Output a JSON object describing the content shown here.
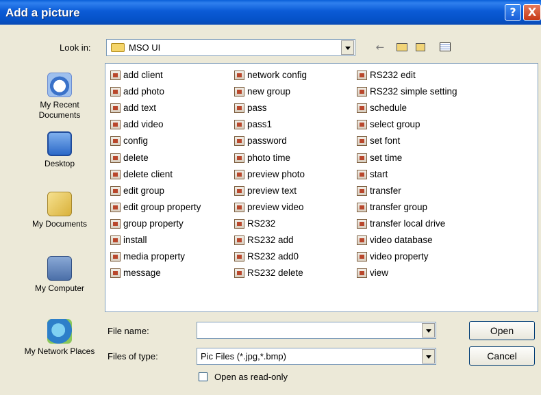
{
  "window": {
    "title": "Add a picture",
    "help_glyph": "?",
    "close_glyph": "X"
  },
  "look_in": {
    "label": "Look in:",
    "value": "MSO UI",
    "folder_icon": "folder-icon"
  },
  "toolbar": {
    "back_glyph": "←",
    "up_icon": "up-folder-icon",
    "new_folder_icon": "new-folder-icon",
    "views_icon": "views-menu-icon"
  },
  "places": [
    {
      "label": "My Recent Documents",
      "icon": "recent-documents-icon"
    },
    {
      "label": "Desktop",
      "icon": "desktop-icon"
    },
    {
      "label": "My Documents",
      "icon": "my-documents-icon"
    },
    {
      "label": "My Computer",
      "icon": "my-computer-icon"
    },
    {
      "label": "My Network Places",
      "icon": "network-places-icon"
    }
  ],
  "files": {
    "col1": [
      "add client",
      "add photo",
      "add text",
      "add video",
      "config",
      "delete",
      "delete client",
      "edit group",
      "edit group property",
      "group property",
      "install",
      "media property",
      "message"
    ],
    "col2": [
      "network config",
      "new group",
      "pass",
      "pass1",
      "password",
      "photo time",
      "preview photo",
      "preview text",
      "preview video",
      "RS232",
      "RS232 add",
      "RS232 add0",
      "RS232 delete"
    ],
    "col3": [
      "RS232 edit",
      "RS232 simple setting",
      "schedule",
      "select group",
      "set font",
      "set time",
      "start",
      "transfer",
      "transfer group",
      "transfer local drive",
      "video database",
      "video property",
      "view"
    ]
  },
  "file_name": {
    "label": "File name:",
    "value": ""
  },
  "file_type": {
    "label": "Files of type:",
    "value": "Pic Files (*.jpg,*.bmp)"
  },
  "buttons": {
    "open": "Open",
    "cancel": "Cancel"
  },
  "read_only": {
    "label": "Open as read-only",
    "checked": false
  }
}
